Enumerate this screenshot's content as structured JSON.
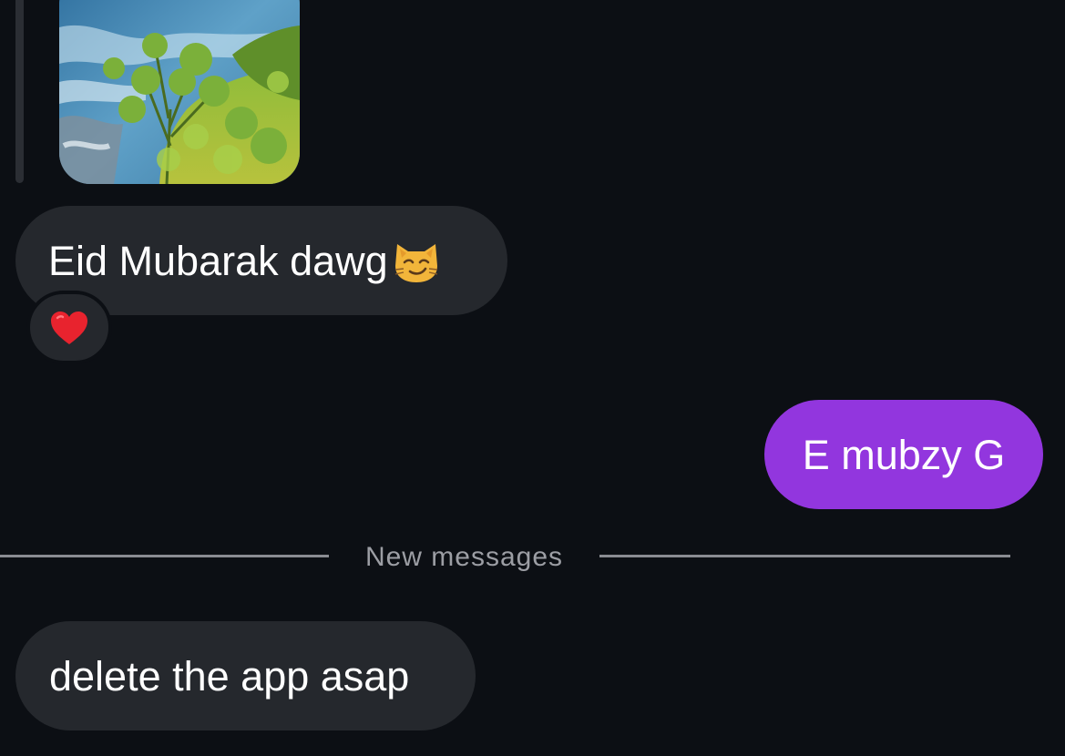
{
  "conversation": {
    "messages": [
      {
        "direction": "incoming",
        "text": "Eid Mubarak dawg",
        "emoji": "smirking-cat",
        "reaction": "red-heart"
      },
      {
        "direction": "outgoing",
        "text": "E mubzy G"
      },
      {
        "direction": "incoming",
        "text": "delete the app asap"
      }
    ],
    "divider_label": "New messages"
  },
  "colors": {
    "background": "#0c0f14",
    "incoming_bubble": "#25282d",
    "outgoing_bubble": "#9236de",
    "divider": "#8a8c92",
    "text": "#ffffff"
  }
}
